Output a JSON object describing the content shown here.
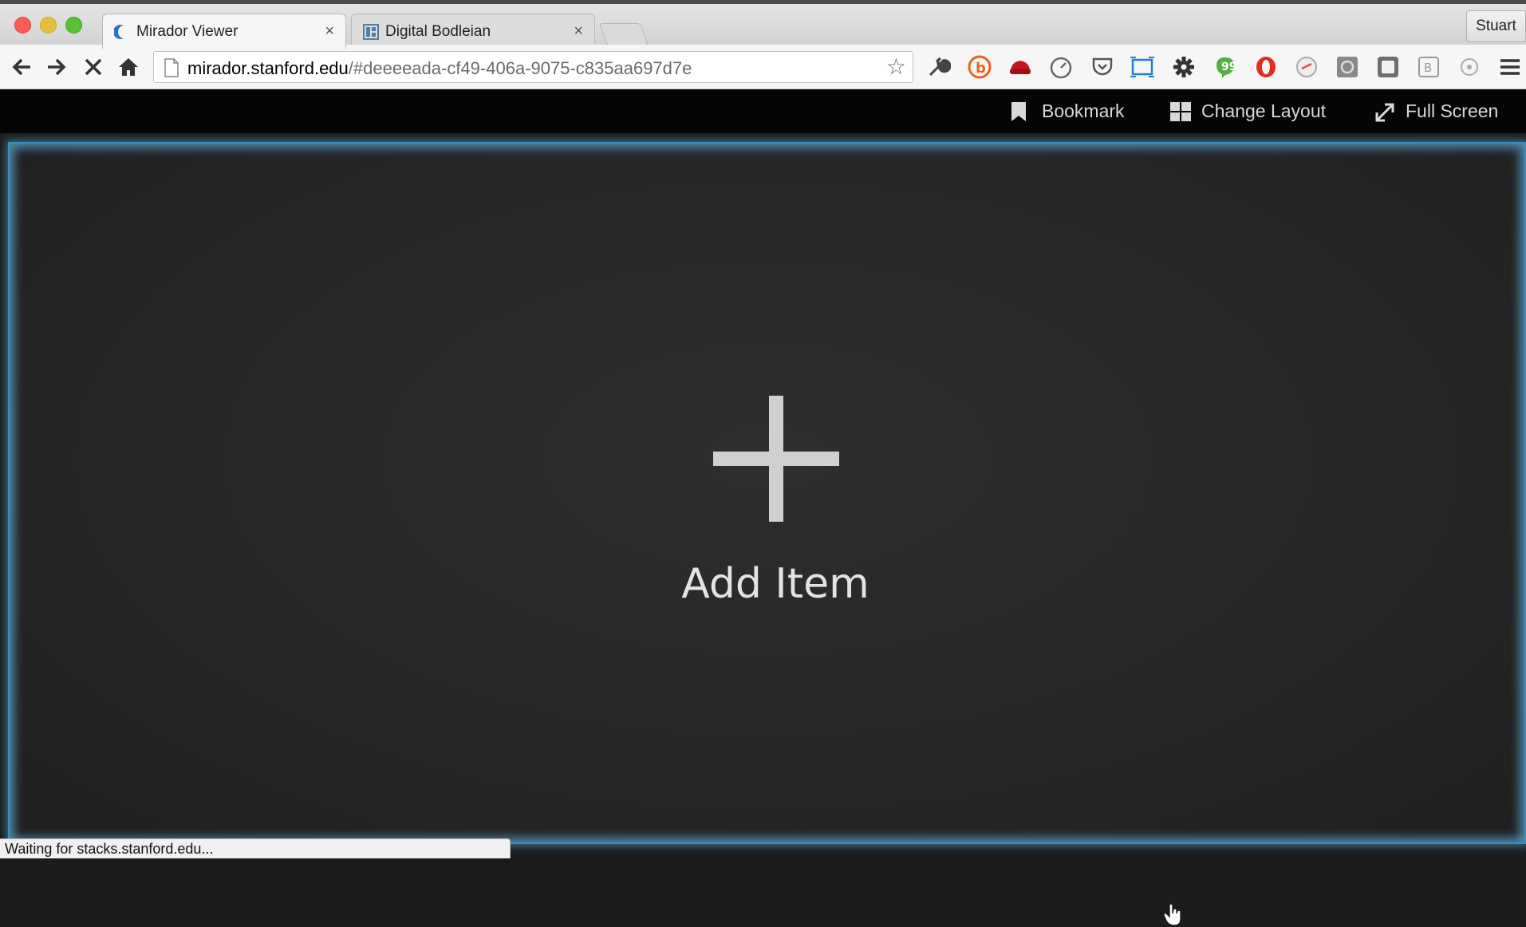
{
  "browser": {
    "tabs": [
      {
        "title": "Mirador Viewer",
        "close_glyph": "×",
        "favicon": "crescent-icon",
        "active": true
      },
      {
        "title": "Digital Bodleian",
        "close_glyph": "×",
        "favicon": "layout-grid-icon",
        "active": false
      }
    ],
    "profile_name": "Stuart",
    "address": {
      "host": "mirador.stanford.edu",
      "path": "/#deeeeada-cf49-406a-9075-c835aa697d7e"
    },
    "status_text": "Waiting for stacks.stanford.edu..."
  },
  "mirador": {
    "menu": [
      {
        "label": "Bookmark",
        "icon": "bookmark-icon"
      },
      {
        "label": "Change Layout",
        "icon": "layout-grid-icon"
      },
      {
        "label": "Full Screen",
        "icon": "expand-icon"
      }
    ],
    "add_item": {
      "glyph": "+",
      "label": "Add Item"
    }
  },
  "colors": {
    "workspace_glow": "#5aaad7",
    "workspace_bg": "#272727",
    "topbar_bg": "#050505"
  }
}
